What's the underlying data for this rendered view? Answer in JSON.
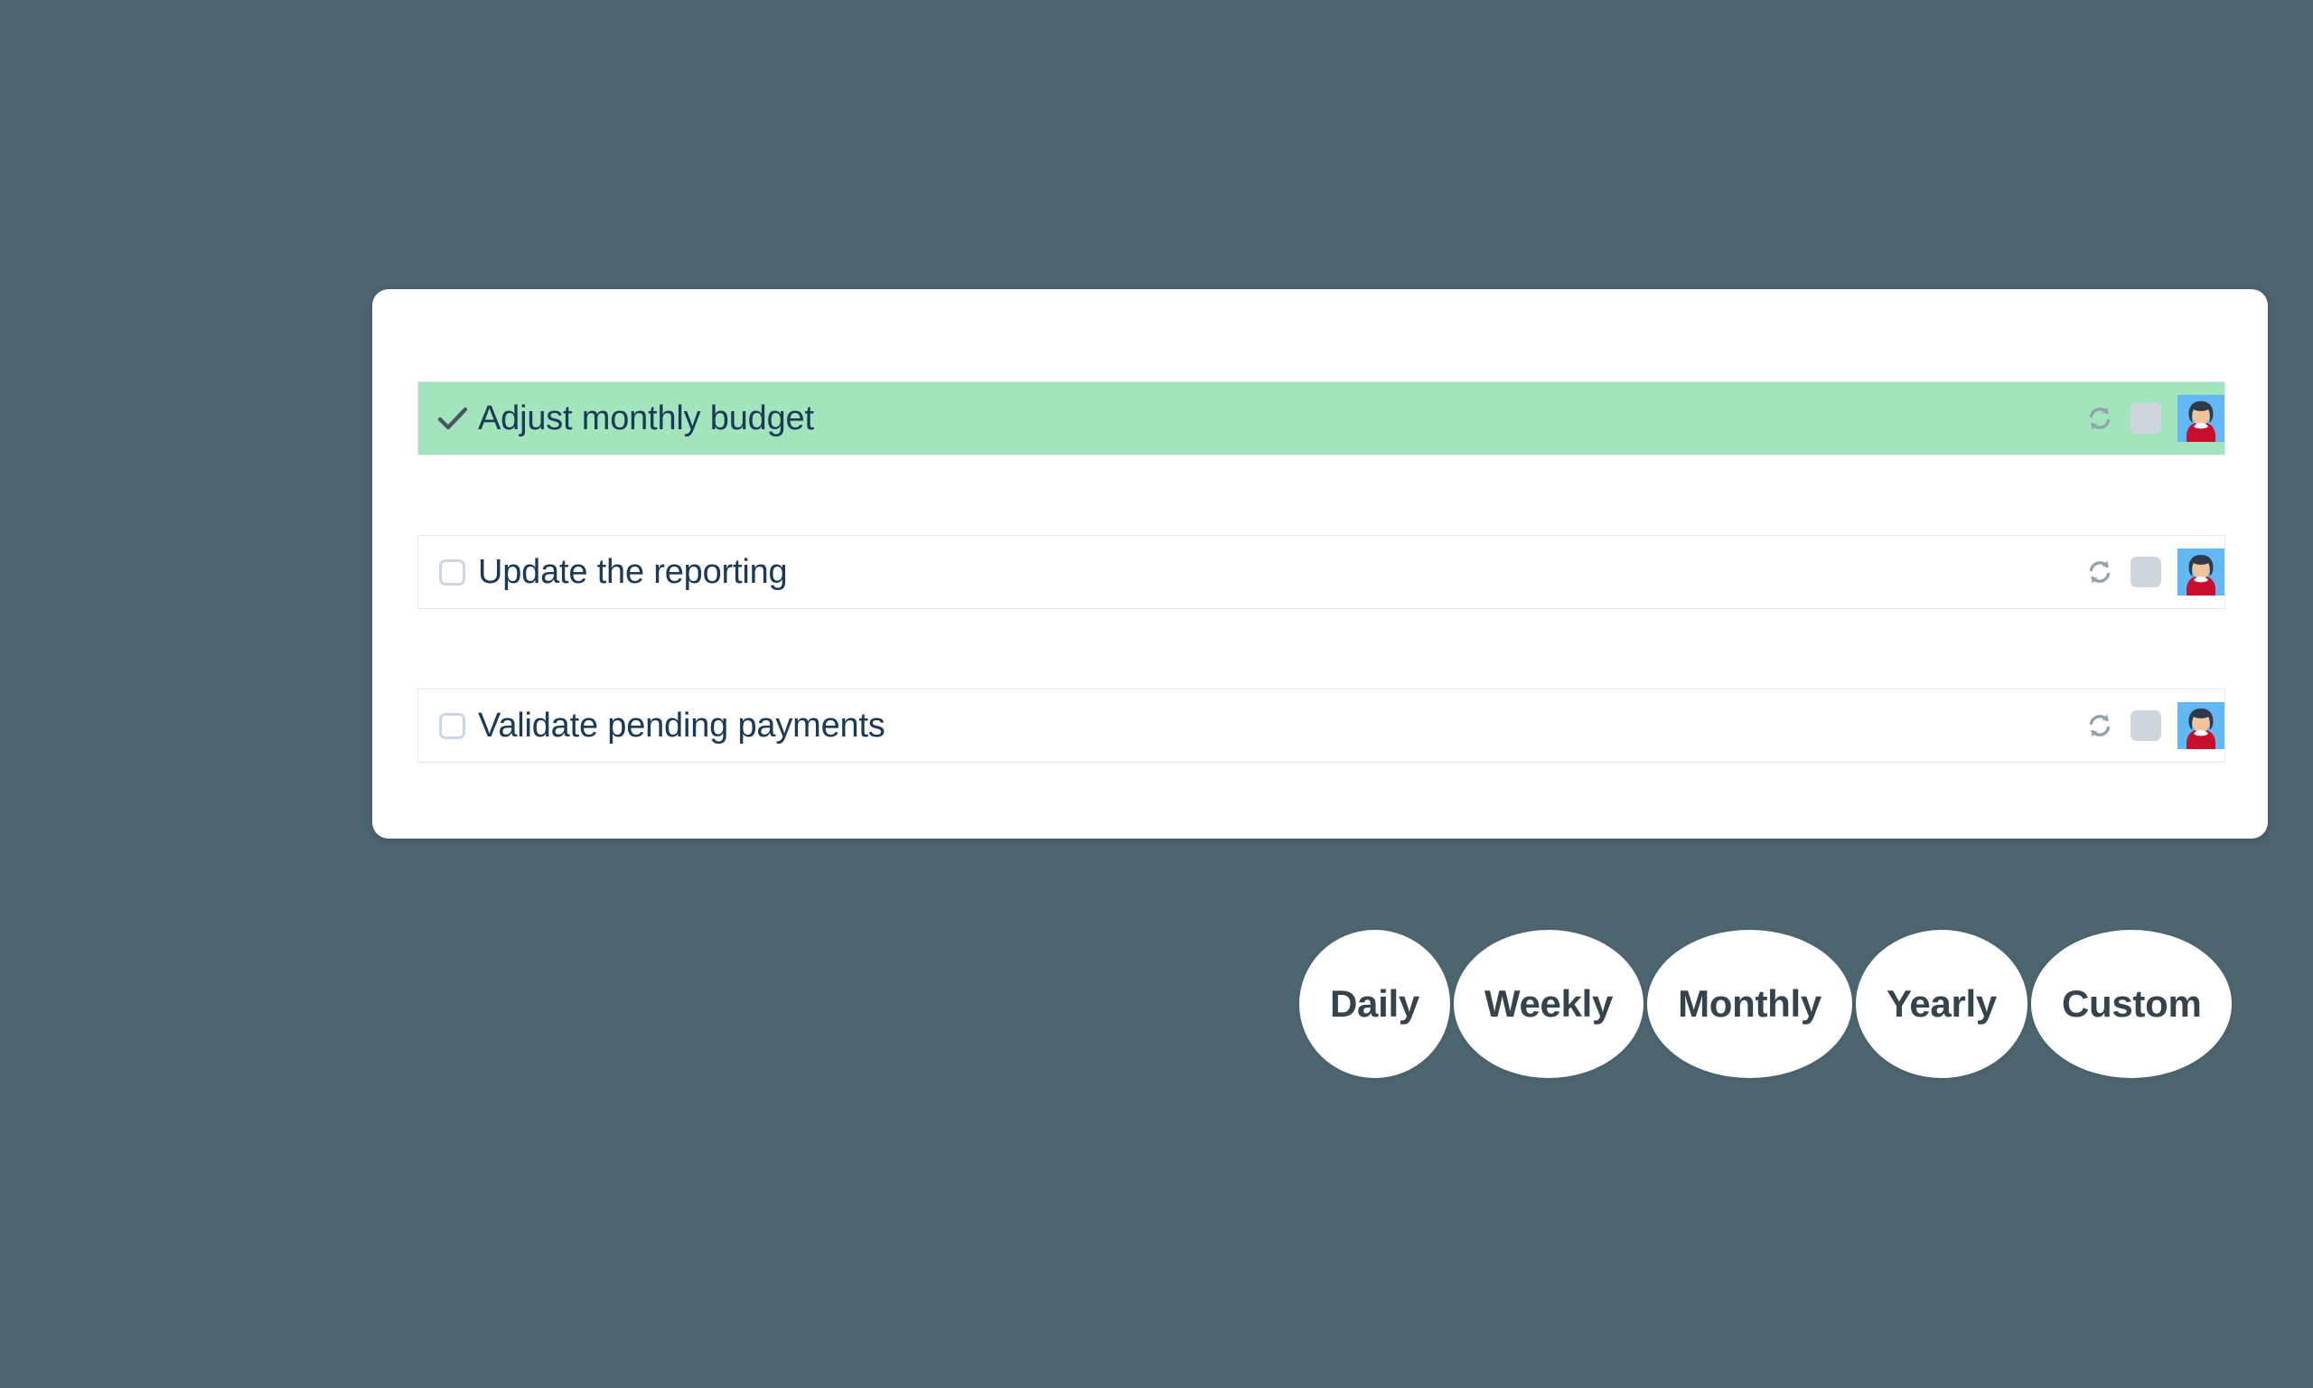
{
  "theme": {
    "background_color": "#4c6670",
    "card_color": "#ffffff",
    "completed_row_color": "#a2e5bd",
    "text_color": "#1b3a57",
    "pill_text_color": "#35434c",
    "checkbox_border_color": "#ccd6e0",
    "sync_icon_color": "#8fa3b0",
    "grey_square_color": "#ced5dd",
    "avatar_background_color": "#62b8f5"
  },
  "task_card": {
    "tasks": [
      {
        "label": "Adjust monthly budget",
        "completed": true,
        "check_icon": "check-icon",
        "sync_icon": "sync-icon",
        "toggle_icon": "grey-square-toggle",
        "avatar_icon": "avatar-woman"
      },
      {
        "label": "Update the reporting",
        "completed": false,
        "check_icon": "checkbox-unchecked-icon",
        "sync_icon": "sync-icon",
        "toggle_icon": "grey-square-toggle",
        "avatar_icon": "avatar-woman"
      },
      {
        "label": "Validate pending payments",
        "completed": false,
        "check_icon": "checkbox-unchecked-icon",
        "sync_icon": "sync-icon",
        "toggle_icon": "grey-square-toggle",
        "avatar_icon": "avatar-woman"
      }
    ]
  },
  "pill_bar": {
    "options": [
      {
        "label": "Daily"
      },
      {
        "label": "Weekly"
      },
      {
        "label": "Monthly"
      },
      {
        "label": "Yearly"
      },
      {
        "label": "Custom"
      }
    ]
  }
}
